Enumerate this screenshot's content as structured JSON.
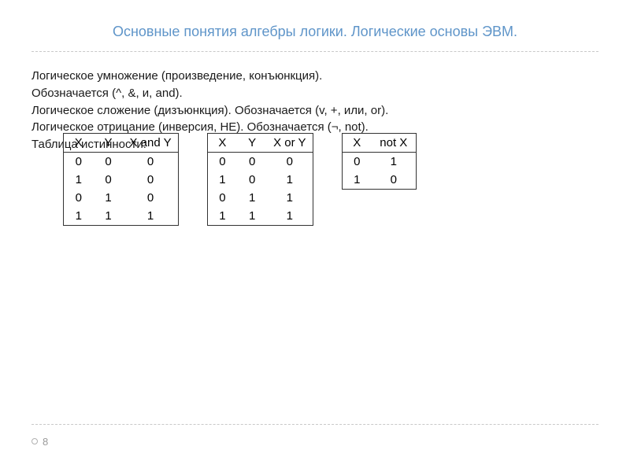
{
  "slide": {
    "title": "Основные понятия алгебры логики. Логические основы ЭВМ.",
    "lines": {
      "l1": "Логическое умножение (произведение, конъюнкция).",
      "l2": "Обозначается (^, &, и, and).",
      "l3": "Логическое сложение (дизъюнкция). Обозначается (v, +, или, or).",
      "l4": "Логическое отрицание (инверсия, НЕ). Обозначается (¬, not).",
      "l5": "Таблица истинности:"
    },
    "tables": {
      "and": {
        "headers": [
          "X",
          "Y",
          "X and Y"
        ],
        "rows": [
          [
            "0",
            "0",
            "0"
          ],
          [
            "1",
            "0",
            "0"
          ],
          [
            "0",
            "1",
            "0"
          ],
          [
            "1",
            "1",
            "1"
          ]
        ]
      },
      "or": {
        "headers": [
          "X",
          "Y",
          "X or Y"
        ],
        "rows": [
          [
            "0",
            "0",
            "0"
          ],
          [
            "1",
            "0",
            "1"
          ],
          [
            "0",
            "1",
            "1"
          ],
          [
            "1",
            "1",
            "1"
          ]
        ]
      },
      "not": {
        "headers": [
          "X",
          "not X"
        ],
        "rows": [
          [
            "0",
            "1"
          ],
          [
            "1",
            "0"
          ]
        ]
      }
    },
    "page_number": "8"
  }
}
